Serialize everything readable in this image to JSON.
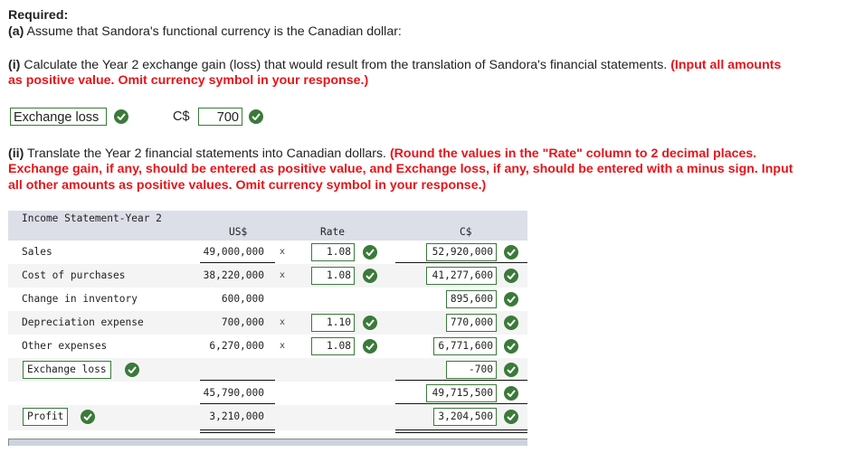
{
  "required_label": "Required:",
  "part_a": {
    "prefix": "(a)",
    "text": " Assume that Sandora's functional currency is the Canadian dollar:"
  },
  "part_i": {
    "prefix": "(i)",
    "text": " Calculate the Year 2 exchange gain (loss) that would result from the translation of Sandora's financial statements. ",
    "instruction_line1": "(Input all amounts",
    "instruction_line2": "as positive value. Omit currency symbol in your response.)",
    "answer_type": "Exchange loss",
    "currency_label": "C$",
    "answer_value": "700"
  },
  "part_ii": {
    "prefix": "(ii)",
    "text": " Translate the Year 2 financial statements into Canadian dollars. ",
    "instruction_line1": "(Round the values in the \"Rate\" column to 2 decimal places.",
    "instruction_line2": "Exchange gain, if any, should be entered as positive value, and Exchange loss, if any, should be entered with a minus sign. Input",
    "instruction_line3": "all other amounts as positive values. Omit currency symbol in your response.)"
  },
  "table": {
    "title": "Income Statement-Year 2",
    "col_usd": "US$",
    "col_rate": "Rate",
    "col_cad": "C$",
    "multiply_sign": "x",
    "rows": [
      {
        "label": "Sales",
        "usd": "49,000,000",
        "rate": "1.08",
        "cad": "52,920,000"
      },
      {
        "label": "Cost of purchases",
        "usd": "38,220,000",
        "rate": "1.08",
        "cad": "41,277,600"
      },
      {
        "label": "Change in inventory",
        "usd": "600,000",
        "rate": "",
        "cad": "895,600"
      },
      {
        "label": "Depreciation expense",
        "usd": "700,000",
        "rate": "1.10",
        "cad": "770,000"
      },
      {
        "label": "Other expenses",
        "usd": "6,270,000",
        "rate": "1.08",
        "cad": "6,771,600"
      },
      {
        "label": "Exchange loss",
        "usd": "",
        "rate": "",
        "cad": "-700"
      },
      {
        "label": "",
        "usd": "45,790,000",
        "rate": "",
        "cad": "49,715,500"
      },
      {
        "label": "Profit",
        "usd": "3,210,000",
        "rate": "",
        "cad": "3,204,500"
      }
    ]
  },
  "status": {
    "correct_icon": "check-circle-icon",
    "correct_color": "#3a7a3a",
    "instruction_color": "#e8141a"
  }
}
